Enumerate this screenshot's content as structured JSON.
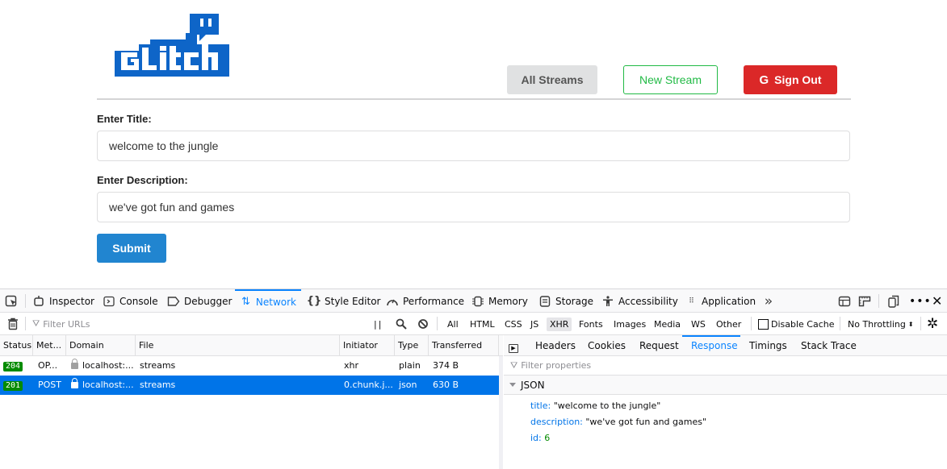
{
  "app": {
    "logo_text": "GLITCH",
    "nav": {
      "all_streams": "All Streams",
      "new_stream": "New Stream",
      "sign_out": "Sign Out",
      "sign_out_icon": "G"
    },
    "form": {
      "title_label": "Enter Title:",
      "title_value": "welcome to the jungle",
      "description_label": "Enter Description:",
      "description_value": "we've got fun and games",
      "submit": "Submit"
    },
    "colors": {
      "brand_blue": "#0e65c8",
      "submit_blue": "#2185d0",
      "new_stream_green": "#21ba45",
      "sign_out_red": "#db2828"
    }
  },
  "devtools": {
    "tools": [
      {
        "label": "Inspector",
        "icon": "inspector-icon"
      },
      {
        "label": "Console",
        "icon": "console-icon"
      },
      {
        "label": "Debugger",
        "icon": "debugger-icon"
      },
      {
        "label": "Network",
        "icon": "network-icon",
        "active": true
      },
      {
        "label": "Style Editor",
        "icon": "style-editor-icon"
      },
      {
        "label": "Performance",
        "icon": "performance-icon"
      },
      {
        "label": "Memory",
        "icon": "memory-icon"
      },
      {
        "label": "Storage",
        "icon": "storage-icon"
      },
      {
        "label": "Accessibility",
        "icon": "accessibility-icon"
      },
      {
        "label": "Application",
        "icon": "application-icon"
      }
    ],
    "filter_placeholder": "Filter URLs",
    "type_filters": [
      "All",
      "HTML",
      "CSS",
      "JS",
      "XHR",
      "Fonts",
      "Images",
      "Media",
      "WS",
      "Other"
    ],
    "active_type_filter": "XHR",
    "disable_cache": "Disable Cache",
    "throttling": "No Throttling",
    "columns": [
      "Status",
      "Met...",
      "Domain",
      "File",
      "Initiator",
      "Type",
      "Transferred"
    ],
    "requests": [
      {
        "status": "204",
        "method": "OP...",
        "domain": "localhost:...",
        "file": "streams",
        "initiator": "xhr",
        "type": "plain",
        "transferred": "374 B",
        "selected": false
      },
      {
        "status": "201",
        "method": "POST",
        "domain": "localhost:...",
        "file": "streams",
        "initiator": "0.chunk.j...",
        "type": "json",
        "transferred": "630 B",
        "selected": true
      }
    ],
    "detail_tabs": [
      "Headers",
      "Cookies",
      "Request",
      "Response",
      "Timings",
      "Stack Trace"
    ],
    "active_detail_tab": "Response",
    "filter_properties": "Filter properties",
    "json_section": "JSON",
    "response": {
      "title_key": "title:",
      "title_val": "\"welcome to the jungle\"",
      "description_key": "description:",
      "description_val": "\"we've got fun and games\"",
      "id_key": "id:",
      "id_val": "6"
    }
  }
}
